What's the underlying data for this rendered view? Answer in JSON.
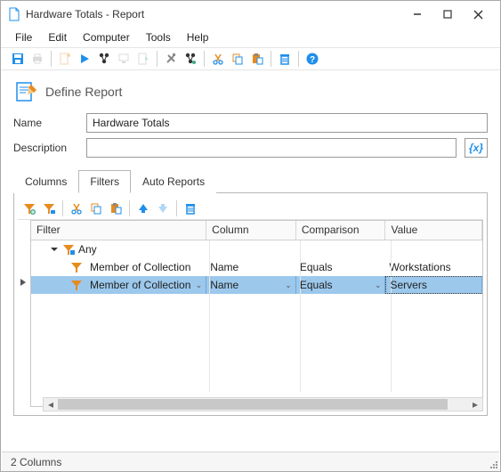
{
  "window": {
    "title": "Hardware Totals - Report"
  },
  "menu": {
    "items": [
      "File",
      "Edit",
      "Computer",
      "Tools",
      "Help"
    ]
  },
  "toolbar": {
    "icons": [
      "save",
      "print",
      "new",
      "play",
      "inventory",
      "computer",
      "export",
      "tools",
      "inventory2",
      "cut",
      "copy",
      "paste",
      "delete",
      "help"
    ]
  },
  "define": {
    "heading": "Define Report",
    "name_label": "Name",
    "name_value": "Hardware Totals",
    "desc_label": "Description",
    "desc_value": "",
    "expr_glyph": "{x}"
  },
  "tabs": {
    "items": [
      "Columns",
      "Filters",
      "Auto Reports"
    ],
    "active_index": 1
  },
  "filter_toolbar": {
    "icons": [
      "funnel-add",
      "funnel-sub",
      "cut",
      "copy",
      "paste",
      "arrow-up",
      "arrow-down",
      "delete"
    ]
  },
  "grid": {
    "headers": {
      "filter": "Filter",
      "column": "Column",
      "comparison": "Comparison",
      "value": "Value"
    },
    "root": {
      "label": "Any"
    },
    "rows": [
      {
        "filter": "Member of Collection",
        "column": "Name",
        "comparison": "Equals",
        "value": "Workstations",
        "selected": false
      },
      {
        "filter": "Member of Collection",
        "column": "Name",
        "comparison": "Equals",
        "value": "Servers",
        "selected": true
      }
    ]
  },
  "status": {
    "text": "2 Columns"
  },
  "colors": {
    "accent": "#1f8feb",
    "orange": "#e88b1f"
  }
}
